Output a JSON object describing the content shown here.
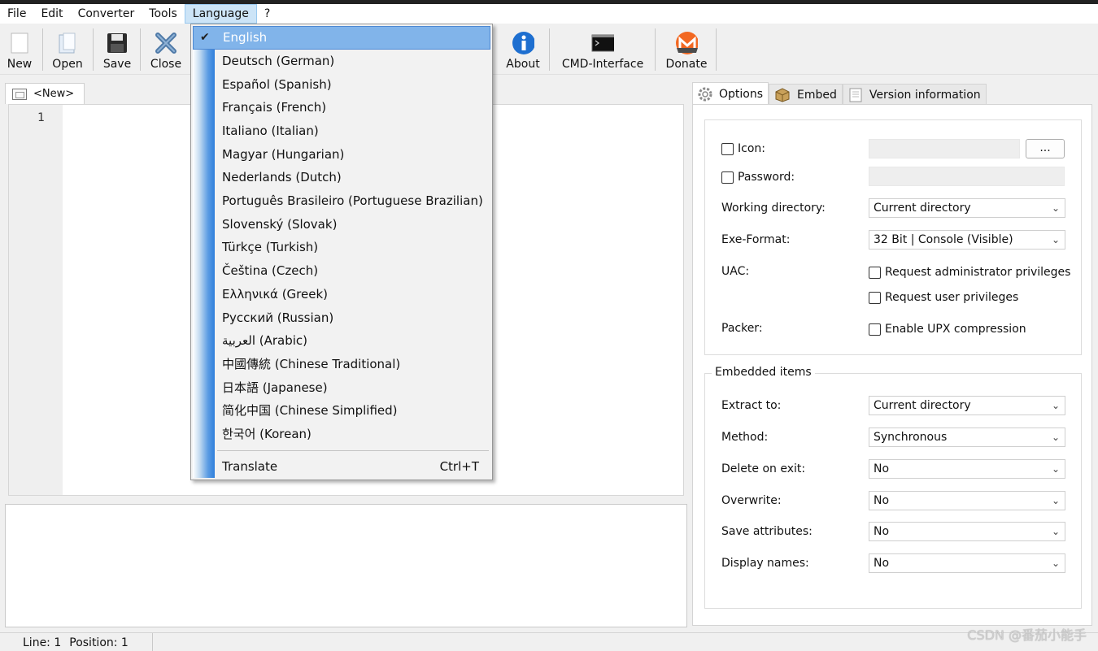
{
  "menubar": {
    "items": [
      "File",
      "Edit",
      "Converter",
      "Tools",
      "Language",
      "?"
    ]
  },
  "toolbar": {
    "new": "New",
    "open": "Open",
    "save": "Save",
    "close": "Close",
    "about": "About",
    "cmd": "CMD-Interface",
    "donate": "Donate"
  },
  "editor": {
    "tab_label": "<New>",
    "first_line_number": "1"
  },
  "language_menu": {
    "items": [
      "English",
      "Deutsch (German)",
      "Español (Spanish)",
      "Français (French)",
      "Italiano (Italian)",
      "Magyar (Hungarian)",
      "Nederlands (Dutch)",
      "Português Brasileiro (Portuguese Brazilian)",
      "Slovenský (Slovak)",
      "Türkçe (Turkish)",
      "Čeština (Czech)",
      "Ελληνικά (Greek)",
      "Русский (Russian)",
      "العربية (Arabic)",
      "中國傳統 (Chinese Traditional)",
      "日本語 (Japanese)",
      "简化中国 (Chinese Simplified)",
      "한국어 (Korean)"
    ],
    "selected": "English",
    "translate_label": "Translate",
    "translate_shortcut": "Ctrl+T"
  },
  "right_panel": {
    "tabs": [
      "Options",
      "Embed",
      "Version information"
    ],
    "options": {
      "icon_label": "Icon:",
      "browse_label": "...",
      "password_label": "Password:",
      "working_dir_label": "Working directory:",
      "working_dir_value": "Current directory",
      "exe_format_label": "Exe-Format:",
      "exe_format_value": "32 Bit | Console (Visible)",
      "uac_label": "UAC:",
      "uac_admin": "Request administrator privileges",
      "uac_user": "Request user privileges",
      "packer_label": "Packer:",
      "packer_upx": "Enable UPX compression"
    },
    "embedded": {
      "title": "Embedded items",
      "extract_label": "Extract to:",
      "extract_value": "Current directory",
      "method_label": "Method:",
      "method_value": "Synchronous",
      "delete_label": "Delete on exit:",
      "delete_value": "No",
      "overwrite_label": "Overwrite:",
      "overwrite_value": "No",
      "save_attr_label": "Save attributes:",
      "save_attr_value": "No",
      "display_names_label": "Display names:",
      "display_names_value": "No"
    }
  },
  "statusbar": {
    "line": "Line: 1",
    "position": "Position: 1"
  },
  "watermark": "CSDN @番茄小能手",
  "colors": {
    "menu_highlight": "#81b4ea",
    "accent_blue": "#2f7fdc"
  }
}
